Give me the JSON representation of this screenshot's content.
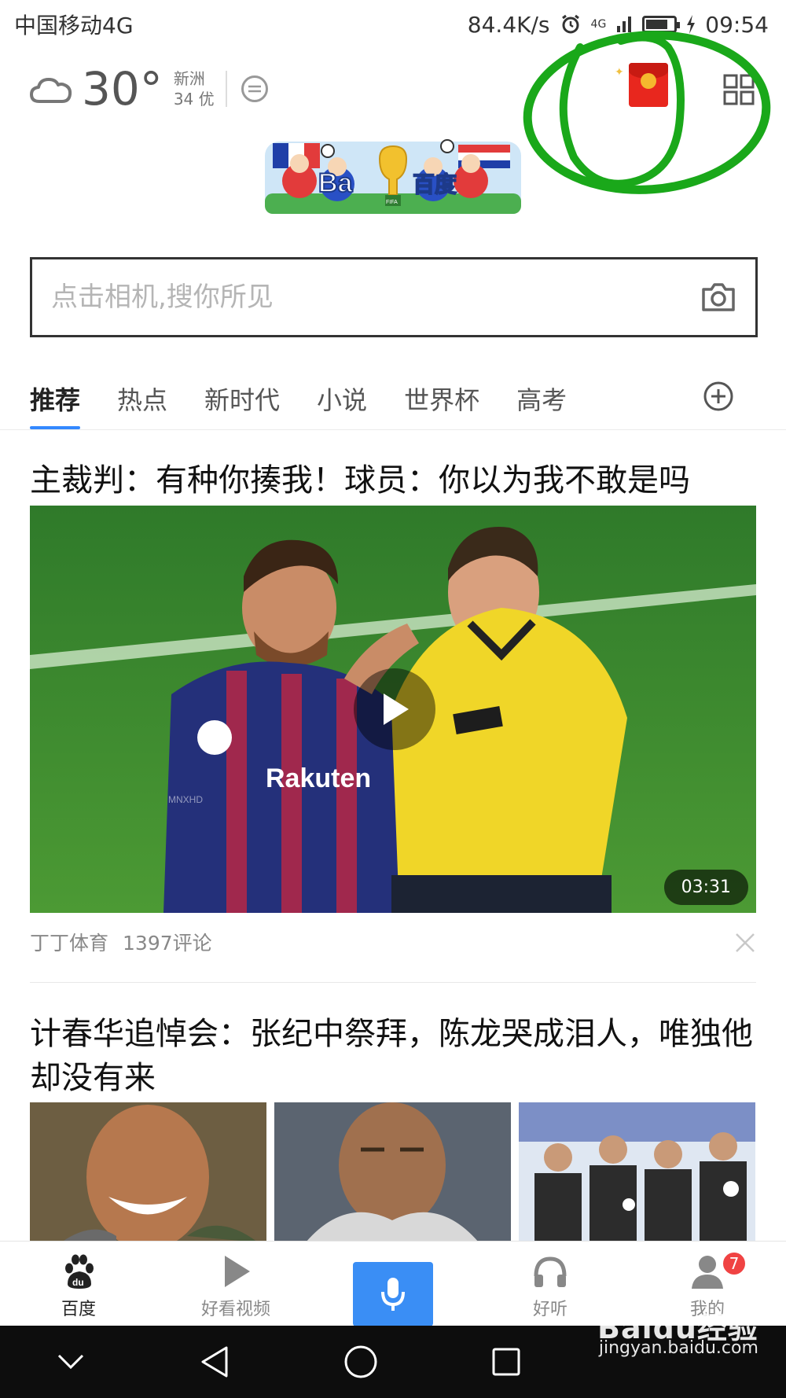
{
  "status_bar": {
    "carrier": "中国移动4G",
    "net_speed": "84.4K/s",
    "signal_label": "4G",
    "time": "09:54",
    "battery_level": 0.8
  },
  "weather": {
    "temperature": "30°",
    "city": "新洲",
    "aqi": "34 优",
    "icon": "cloud-icon"
  },
  "doodle": {
    "text_left": "Ba",
    "text_right": "百度",
    "trophy_label": "FIFA"
  },
  "search": {
    "placeholder": "点击相机,搜你所见",
    "value": ""
  },
  "tabs": [
    {
      "label": "推荐",
      "active": true
    },
    {
      "label": "热点",
      "active": false
    },
    {
      "label": "新时代",
      "active": false
    },
    {
      "label": "小说",
      "active": false
    },
    {
      "label": "世界杯",
      "active": false
    },
    {
      "label": "高考",
      "active": false
    }
  ],
  "feed": [
    {
      "title": "主裁判：有种你揍我！球员：你以为我不敢是吗",
      "type": "video",
      "duration": "03:31",
      "source": "丁丁体育",
      "comments": "1397评论",
      "overlay_texts": [
        "Rakuten",
        "MNXHD"
      ]
    },
    {
      "title": "计春华追悼会：张纪中祭拜，陈龙哭成泪人，唯独他却没有来",
      "type": "gallery",
      "image_count": 3
    }
  ],
  "bottom_nav": [
    {
      "label": "百度",
      "icon": "baidu-paw-icon",
      "active": true
    },
    {
      "label": "好看视频",
      "icon": "play-icon",
      "active": false
    },
    {
      "label": "",
      "icon": "microphone-icon",
      "active": false
    },
    {
      "label": "好听",
      "icon": "headphones-icon",
      "active": false
    },
    {
      "label": "我的",
      "icon": "user-icon",
      "active": false,
      "badge": "7"
    }
  ],
  "watermark": {
    "brand": "Baidu经验",
    "url": "jingyan.baidu.com"
  },
  "colors": {
    "accent": "#3a8ef5",
    "red_packet": "#e8271e",
    "annotation_circle": "#1aa81a",
    "badge": "#f04343"
  }
}
